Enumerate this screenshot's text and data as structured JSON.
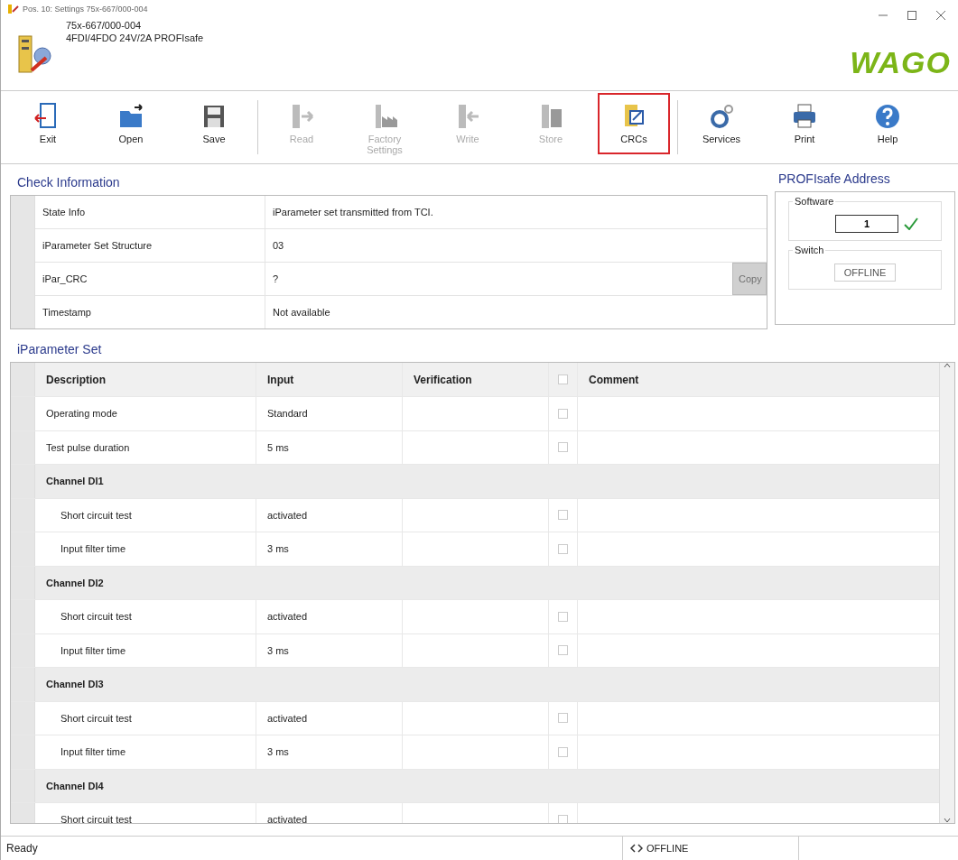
{
  "window": {
    "title": "Pos. 10: Settings 75x-667/000-004"
  },
  "header": {
    "lines": [
      "75x-667/000-004",
      "4FDI/4FDO 24V/2A PROFIsafe"
    ],
    "logo": "WAGO"
  },
  "toolbar": [
    {
      "label": "Exit",
      "disabled": false,
      "selected": false
    },
    {
      "label": "Open",
      "disabled": false,
      "selected": false
    },
    {
      "label": "Save",
      "disabled": false,
      "selected": false,
      "separator_after": true
    },
    {
      "label": "Read",
      "disabled": true,
      "selected": false
    },
    {
      "label": "Factory Settings",
      "disabled": true,
      "selected": false
    },
    {
      "label": "Write",
      "disabled": true,
      "selected": false
    },
    {
      "label": "Store",
      "disabled": true,
      "selected": false
    },
    {
      "label": "CRCs",
      "disabled": false,
      "selected": true,
      "separator_after": true
    },
    {
      "label": "Services",
      "disabled": false,
      "selected": false
    },
    {
      "label": "Print",
      "disabled": false,
      "selected": false
    },
    {
      "label": "Help",
      "disabled": false,
      "selected": false
    }
  ],
  "check_information": {
    "title": "Check Information",
    "rows": [
      {
        "label": "State Info",
        "value": "iParameter set transmitted from TCI."
      },
      {
        "label": "iParameter Set Structure",
        "value": "03"
      },
      {
        "label": "iPar_CRC",
        "value": "?",
        "button": {
          "label": "Copy",
          "disabled": true
        }
      },
      {
        "label": "Timestamp",
        "value": "Not available"
      }
    ]
  },
  "profisafe_address": {
    "title": "PROFIsafe Address",
    "software": {
      "label": "Software",
      "value": "1",
      "valid": true
    },
    "switch": {
      "label": "Switch",
      "value": "OFFLINE"
    }
  },
  "iparameter_set": {
    "title": "iParameter Set",
    "columns": [
      "Description",
      "Input",
      "Verification",
      "Comment"
    ],
    "header_checked": false,
    "rows": [
      {
        "kind": "param",
        "description": "Operating mode",
        "input": "Standard",
        "checked": false
      },
      {
        "kind": "param",
        "description": "Test pulse duration",
        "input": "5 ms",
        "checked": false
      },
      {
        "kind": "group",
        "description": "Channel DI1",
        "children": [
          {
            "kind": "param",
            "description": "Short circuit test",
            "input": "activated",
            "checked": false
          },
          {
            "kind": "param",
            "description": "Input filter time",
            "input": "3 ms",
            "checked": false
          }
        ]
      },
      {
        "kind": "group",
        "description": "Channel DI2",
        "children": [
          {
            "kind": "param",
            "description": "Short circuit test",
            "input": "activated",
            "checked": false
          },
          {
            "kind": "param",
            "description": "Input filter time",
            "input": "3 ms",
            "checked": false
          }
        ]
      },
      {
        "kind": "group",
        "description": "Channel DI3",
        "children": [
          {
            "kind": "param",
            "description": "Short circuit test",
            "input": "activated",
            "checked": false
          },
          {
            "kind": "param",
            "description": "Input filter time",
            "input": "3 ms",
            "checked": false
          }
        ]
      },
      {
        "kind": "group",
        "description": "Channel DI4",
        "children": [
          {
            "kind": "param",
            "description": "Short circuit test",
            "input": "activated",
            "checked": false
          }
        ]
      }
    ]
  },
  "status_bar": {
    "message": "Ready",
    "connection": "OFFLINE"
  }
}
